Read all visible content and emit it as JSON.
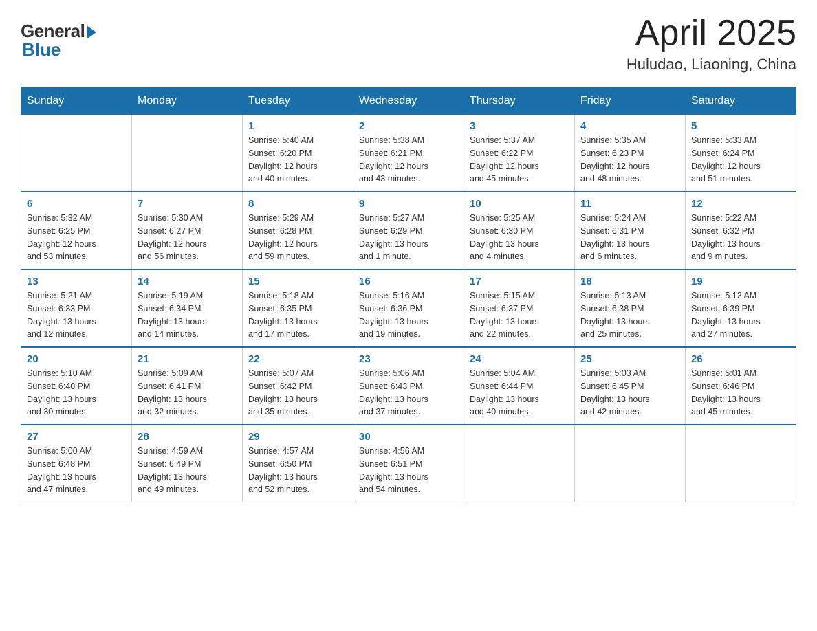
{
  "logo": {
    "general": "General",
    "blue": "Blue"
  },
  "title": "April 2025",
  "location": "Huludao, Liaoning, China",
  "headers": [
    "Sunday",
    "Monday",
    "Tuesday",
    "Wednesday",
    "Thursday",
    "Friday",
    "Saturday"
  ],
  "weeks": [
    [
      {
        "day": "",
        "info": ""
      },
      {
        "day": "",
        "info": ""
      },
      {
        "day": "1",
        "info": "Sunrise: 5:40 AM\nSunset: 6:20 PM\nDaylight: 12 hours\nand 40 minutes."
      },
      {
        "day": "2",
        "info": "Sunrise: 5:38 AM\nSunset: 6:21 PM\nDaylight: 12 hours\nand 43 minutes."
      },
      {
        "day": "3",
        "info": "Sunrise: 5:37 AM\nSunset: 6:22 PM\nDaylight: 12 hours\nand 45 minutes."
      },
      {
        "day": "4",
        "info": "Sunrise: 5:35 AM\nSunset: 6:23 PM\nDaylight: 12 hours\nand 48 minutes."
      },
      {
        "day": "5",
        "info": "Sunrise: 5:33 AM\nSunset: 6:24 PM\nDaylight: 12 hours\nand 51 minutes."
      }
    ],
    [
      {
        "day": "6",
        "info": "Sunrise: 5:32 AM\nSunset: 6:25 PM\nDaylight: 12 hours\nand 53 minutes."
      },
      {
        "day": "7",
        "info": "Sunrise: 5:30 AM\nSunset: 6:27 PM\nDaylight: 12 hours\nand 56 minutes."
      },
      {
        "day": "8",
        "info": "Sunrise: 5:29 AM\nSunset: 6:28 PM\nDaylight: 12 hours\nand 59 minutes."
      },
      {
        "day": "9",
        "info": "Sunrise: 5:27 AM\nSunset: 6:29 PM\nDaylight: 13 hours\nand 1 minute."
      },
      {
        "day": "10",
        "info": "Sunrise: 5:25 AM\nSunset: 6:30 PM\nDaylight: 13 hours\nand 4 minutes."
      },
      {
        "day": "11",
        "info": "Sunrise: 5:24 AM\nSunset: 6:31 PM\nDaylight: 13 hours\nand 6 minutes."
      },
      {
        "day": "12",
        "info": "Sunrise: 5:22 AM\nSunset: 6:32 PM\nDaylight: 13 hours\nand 9 minutes."
      }
    ],
    [
      {
        "day": "13",
        "info": "Sunrise: 5:21 AM\nSunset: 6:33 PM\nDaylight: 13 hours\nand 12 minutes."
      },
      {
        "day": "14",
        "info": "Sunrise: 5:19 AM\nSunset: 6:34 PM\nDaylight: 13 hours\nand 14 minutes."
      },
      {
        "day": "15",
        "info": "Sunrise: 5:18 AM\nSunset: 6:35 PM\nDaylight: 13 hours\nand 17 minutes."
      },
      {
        "day": "16",
        "info": "Sunrise: 5:16 AM\nSunset: 6:36 PM\nDaylight: 13 hours\nand 19 minutes."
      },
      {
        "day": "17",
        "info": "Sunrise: 5:15 AM\nSunset: 6:37 PM\nDaylight: 13 hours\nand 22 minutes."
      },
      {
        "day": "18",
        "info": "Sunrise: 5:13 AM\nSunset: 6:38 PM\nDaylight: 13 hours\nand 25 minutes."
      },
      {
        "day": "19",
        "info": "Sunrise: 5:12 AM\nSunset: 6:39 PM\nDaylight: 13 hours\nand 27 minutes."
      }
    ],
    [
      {
        "day": "20",
        "info": "Sunrise: 5:10 AM\nSunset: 6:40 PM\nDaylight: 13 hours\nand 30 minutes."
      },
      {
        "day": "21",
        "info": "Sunrise: 5:09 AM\nSunset: 6:41 PM\nDaylight: 13 hours\nand 32 minutes."
      },
      {
        "day": "22",
        "info": "Sunrise: 5:07 AM\nSunset: 6:42 PM\nDaylight: 13 hours\nand 35 minutes."
      },
      {
        "day": "23",
        "info": "Sunrise: 5:06 AM\nSunset: 6:43 PM\nDaylight: 13 hours\nand 37 minutes."
      },
      {
        "day": "24",
        "info": "Sunrise: 5:04 AM\nSunset: 6:44 PM\nDaylight: 13 hours\nand 40 minutes."
      },
      {
        "day": "25",
        "info": "Sunrise: 5:03 AM\nSunset: 6:45 PM\nDaylight: 13 hours\nand 42 minutes."
      },
      {
        "day": "26",
        "info": "Sunrise: 5:01 AM\nSunset: 6:46 PM\nDaylight: 13 hours\nand 45 minutes."
      }
    ],
    [
      {
        "day": "27",
        "info": "Sunrise: 5:00 AM\nSunset: 6:48 PM\nDaylight: 13 hours\nand 47 minutes."
      },
      {
        "day": "28",
        "info": "Sunrise: 4:59 AM\nSunset: 6:49 PM\nDaylight: 13 hours\nand 49 minutes."
      },
      {
        "day": "29",
        "info": "Sunrise: 4:57 AM\nSunset: 6:50 PM\nDaylight: 13 hours\nand 52 minutes."
      },
      {
        "day": "30",
        "info": "Sunrise: 4:56 AM\nSunset: 6:51 PM\nDaylight: 13 hours\nand 54 minutes."
      },
      {
        "day": "",
        "info": ""
      },
      {
        "day": "",
        "info": ""
      },
      {
        "day": "",
        "info": ""
      }
    ]
  ]
}
